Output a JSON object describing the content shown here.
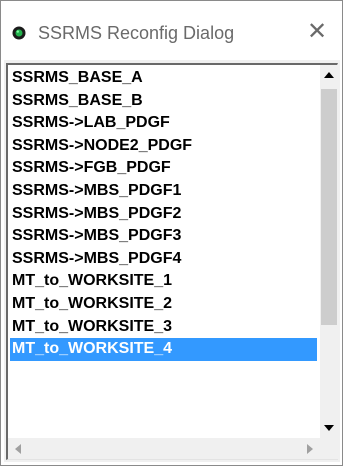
{
  "window": {
    "title": "SSRMS Reconfig Dialog",
    "close_glyph": "✕",
    "app_icon": "green-orb-icon"
  },
  "list": {
    "items": [
      "SSRMS_BASE_A",
      "SSRMS_BASE_B",
      "SSRMS->LAB_PDGF",
      "SSRMS->NODE2_PDGF",
      "SSRMS->FGB_PDGF",
      "SSRMS->MBS_PDGF1",
      "SSRMS->MBS_PDGF2",
      "SSRMS->MBS_PDGF3",
      "SSRMS->MBS_PDGF4",
      "MT_to_WORKSITE_1",
      "MT_to_WORKSITE_2",
      "MT_to_WORKSITE_3",
      "MT_to_WORKSITE_4"
    ],
    "selected_index": 12
  },
  "colors": {
    "selection": "#3399ff",
    "scrollbar_thumb": "#cdcdcd"
  }
}
